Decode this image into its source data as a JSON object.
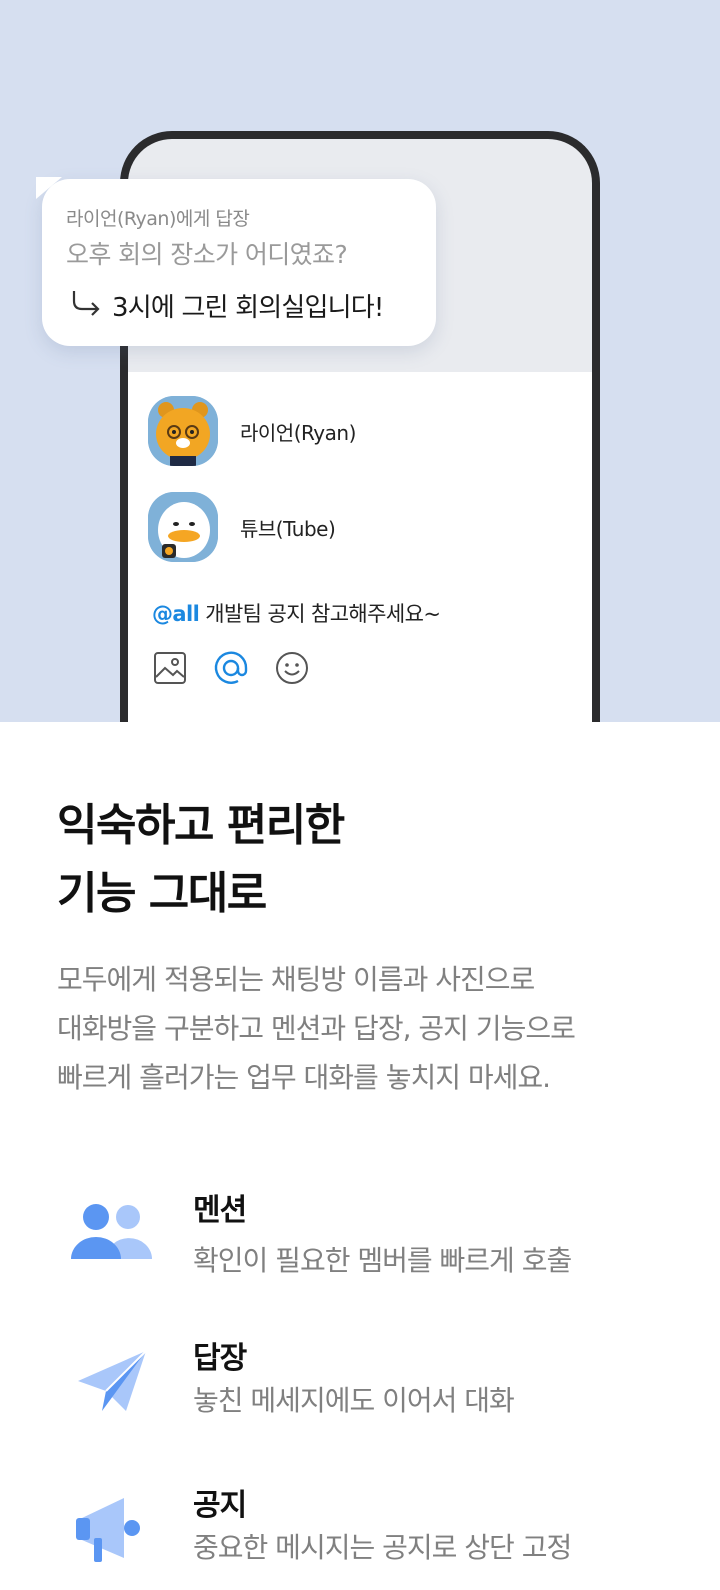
{
  "hero": {
    "bubble": {
      "reply_to": "라이언(Ryan)에게 답장",
      "quoted_message": "오후 회의 장소가 어디였죠?",
      "reply_message": "3시에 그린 회의실입니다!"
    },
    "members": [
      {
        "name": "라이언(Ryan)",
        "avatar_icon": "ryan-avatar"
      },
      {
        "name": "튜브(Tube)",
        "avatar_icon": "tube-avatar"
      }
    ],
    "message": {
      "mention": "@all",
      "text": " 개발팀 공지 참고해주세요~"
    },
    "tools": [
      {
        "icon": "image-icon"
      },
      {
        "icon": "mention-icon",
        "active": true
      },
      {
        "icon": "emoji-icon"
      }
    ]
  },
  "headline": {
    "line1": "익숙하고 편리한",
    "line2": "기능 그대로"
  },
  "description": {
    "line1": "모두에게 적용되는 채팅방 이름과 사진으로",
    "line2": "대화방을 구분하고 멘션과 답장, 공지 기능으로",
    "line3": "빠르게 흘러가는 업무 대화를 놓치지 마세요."
  },
  "features": [
    {
      "title": "멘션",
      "desc": "확인이 필요한 멤버를 빠르게 호출",
      "icon": "people-icon"
    },
    {
      "title": "답장",
      "desc": "놓친 메세지에도 이어서 대화",
      "icon": "paper-plane-icon"
    },
    {
      "title": "공지",
      "desc": "중요한 메시지는 공지로 상단 고정",
      "icon": "megaphone-icon"
    }
  ],
  "colors": {
    "hero_background": "#d6dff0",
    "mention_accent": "#1b88e0",
    "feature_icon_blue": "#5b96f2",
    "feature_icon_light": "#a9c7fa"
  }
}
